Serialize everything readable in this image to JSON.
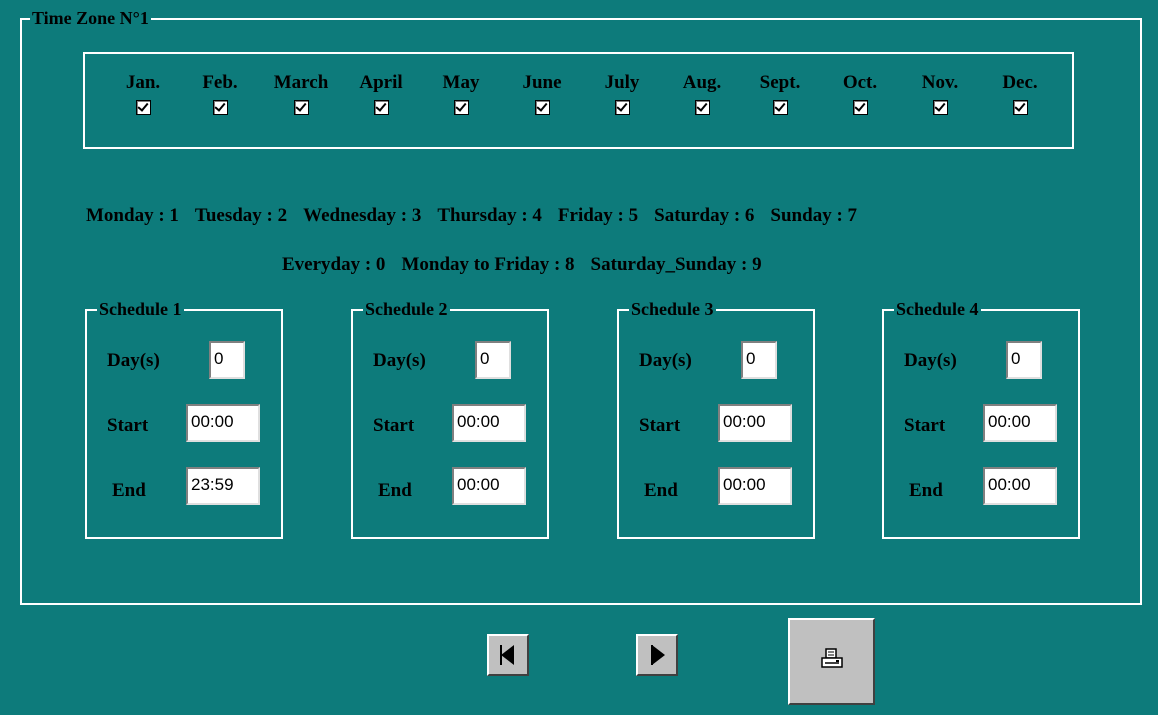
{
  "frame_title": "Time Zone N°1",
  "months": [
    {
      "label": "Jan.",
      "checked": true
    },
    {
      "label": "Feb.",
      "checked": true
    },
    {
      "label": "March",
      "checked": true
    },
    {
      "label": "April",
      "checked": true
    },
    {
      "label": "May",
      "checked": true
    },
    {
      "label": "June",
      "checked": true
    },
    {
      "label": "July",
      "checked": true
    },
    {
      "label": "Aug.",
      "checked": true
    },
    {
      "label": "Sept.",
      "checked": true
    },
    {
      "label": "Oct.",
      "checked": true
    },
    {
      "label": "Nov.",
      "checked": true
    },
    {
      "label": "Dec.",
      "checked": true
    }
  ],
  "legend_line1": [
    "Monday : 1",
    "Tuesday : 2",
    "Wednesday : 3",
    "Thursday : 4",
    "Friday : 5",
    "Saturday : 6",
    "Sunday : 7"
  ],
  "legend_line2": [
    "Everyday : 0",
    "Monday to Friday : 8",
    "Saturday_Sunday : 9"
  ],
  "labels": {
    "days": "Day(s)",
    "start": "Start",
    "end": "End"
  },
  "schedules": [
    {
      "title": "Schedule 1",
      "days": "0",
      "start": "00:00",
      "end": "23:59"
    },
    {
      "title": "Schedule 2",
      "days": "0",
      "start": "00:00",
      "end": "00:00"
    },
    {
      "title": "Schedule 3",
      "days": "0",
      "start": "00:00",
      "end": "00:00"
    },
    {
      "title": "Schedule 4",
      "days": "0",
      "start": "00:00",
      "end": "00:00"
    }
  ],
  "icons": {
    "prev": "previous-arrow-icon",
    "next": "next-arrow-icon",
    "print": "printer-icon"
  },
  "colors": {
    "background": "#0d7b7b",
    "frame": "#ffffff",
    "button": "#c0c0c0"
  }
}
